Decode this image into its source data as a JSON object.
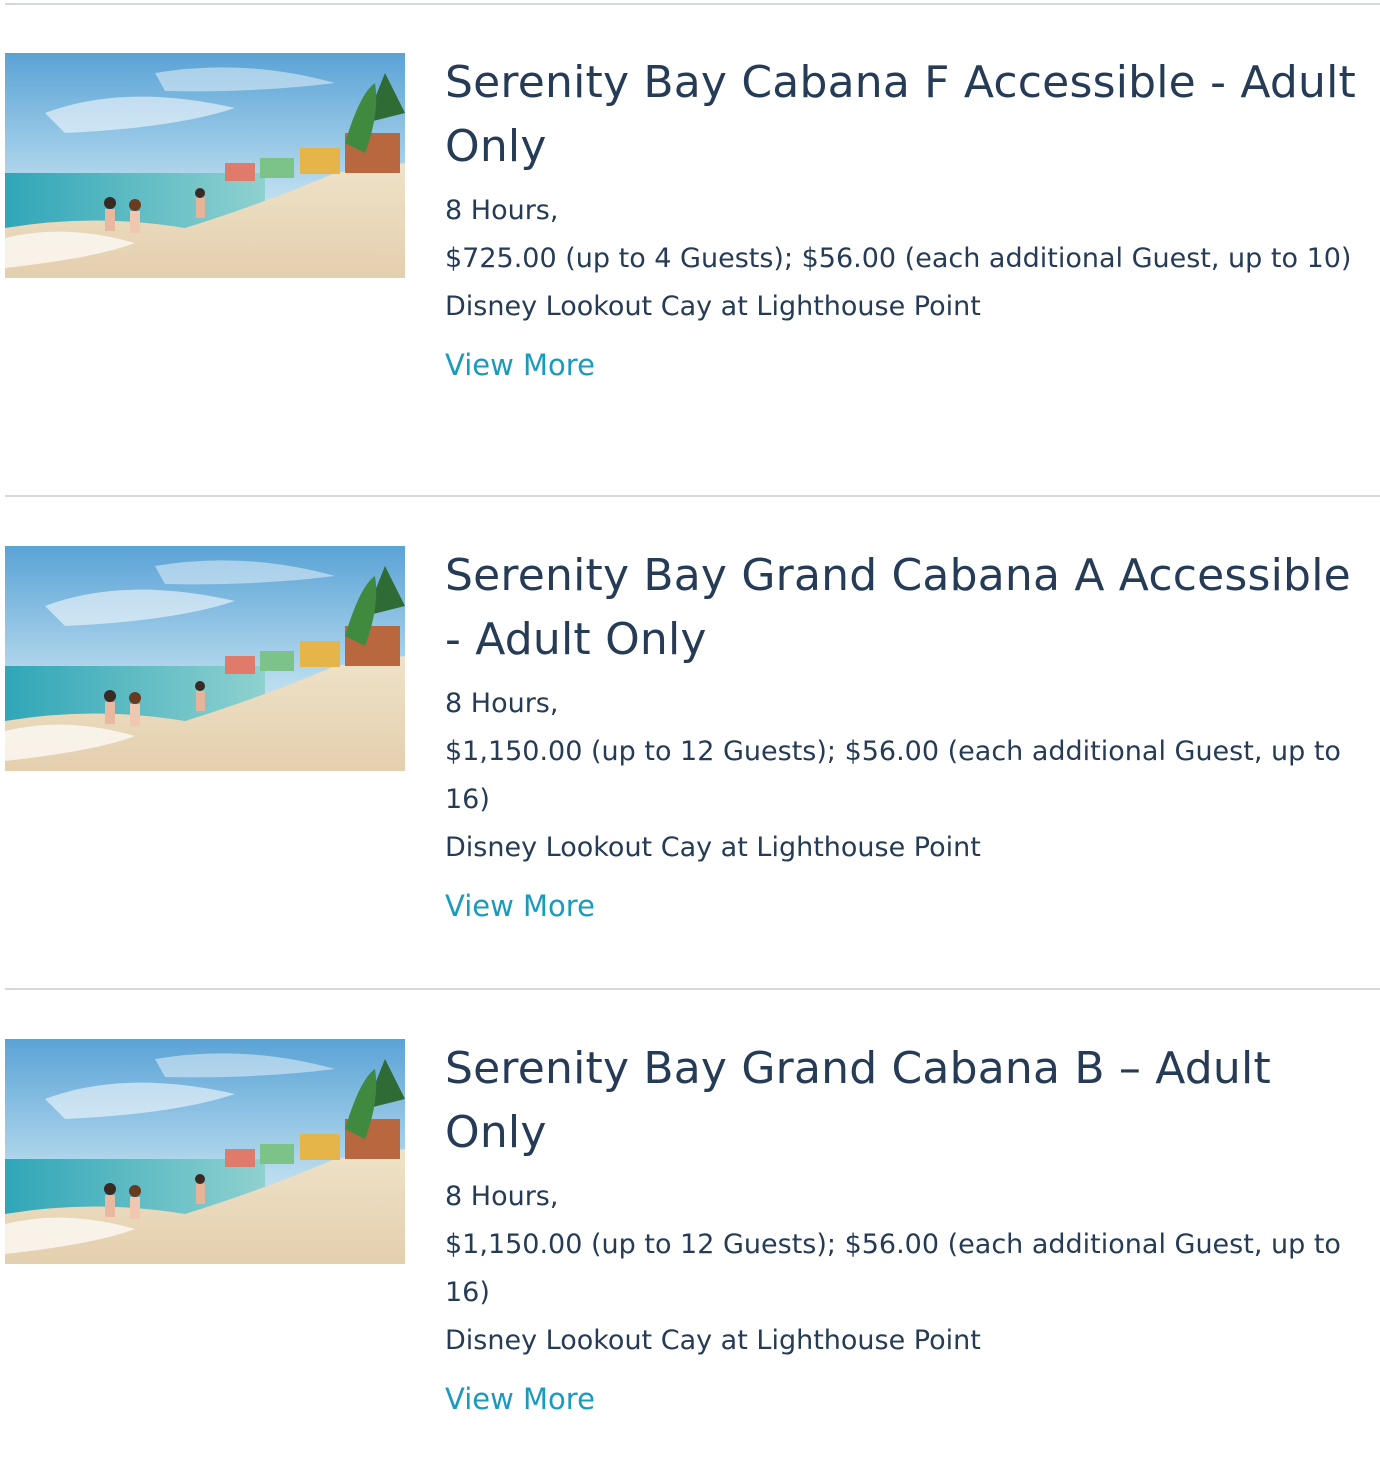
{
  "listings": [
    {
      "title": "Serenity Bay Cabana F Accessible - Adult Only",
      "duration": "8 Hours,",
      "price": "$725.00 (up to 4 Guests); $56.00 (each additional Guest, up to 10)",
      "location": "Disney Lookout Cay at Lighthouse Point",
      "link_label": "View More",
      "image_icon": "beach-image"
    },
    {
      "title": "Serenity Bay Grand Cabana A Accessible - Adult Only",
      "duration": "8 Hours,",
      "price": "$1,150.00 (up to 12 Guests); $56.00 (each additional Guest, up to 16)",
      "location": "Disney Lookout Cay at Lighthouse Point",
      "link_label": "View More",
      "image_icon": "beach-image"
    },
    {
      "title": "Serenity Bay Grand Cabana B – Adult Only",
      "duration": "8 Hours,",
      "price": "$1,150.00 (up to 12 Guests); $56.00 (each additional Guest, up to 16)",
      "location": "Disney Lookout Cay at Lighthouse Point",
      "link_label": "View More",
      "image_icon": "beach-image"
    }
  ],
  "colors": {
    "text": "#253b56",
    "link": "#1a9bbd",
    "divider": "#d5d8e0"
  }
}
